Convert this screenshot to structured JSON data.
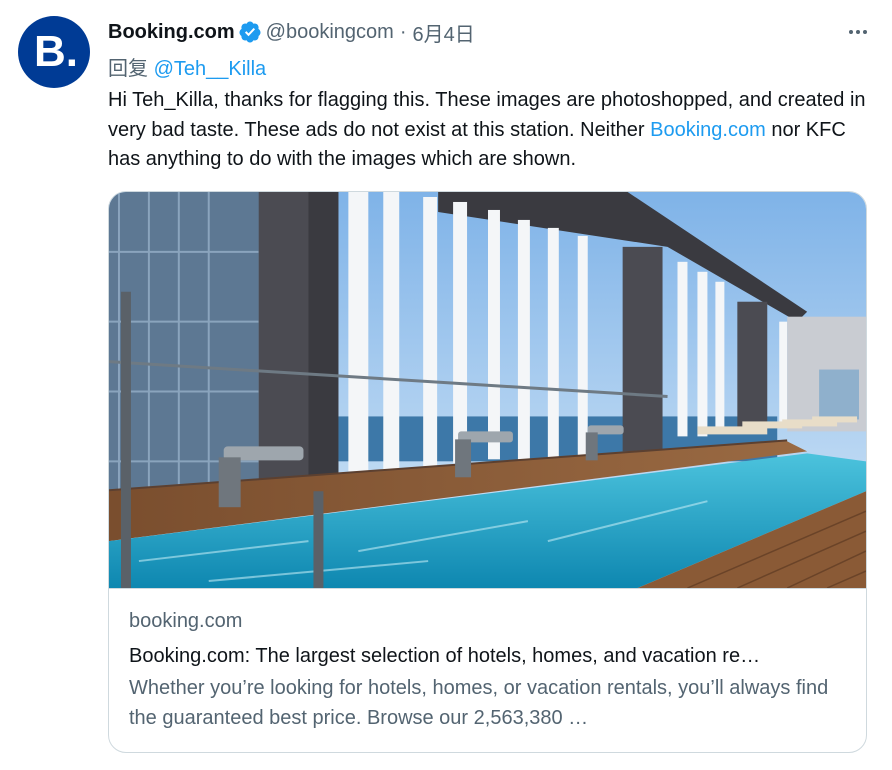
{
  "author": {
    "avatar_letter": "B.",
    "display_name": "Booking.com",
    "handle": "@bookingcom",
    "separator": "·",
    "date": "6月4日"
  },
  "reply": {
    "prefix": "回复",
    "mention": "@Teh__Killa"
  },
  "tweet": {
    "text_part1": "Hi Teh_Killa, thanks for flagging this. These images are photoshopped, and created in very bad taste. These ads do not exist at this station. Neither ",
    "link_text": "Booking.com",
    "text_part2": " nor KFC has anything to do with the images which are shown."
  },
  "card": {
    "domain": "booking.com",
    "title": "Booking.com: The largest selection of hotels, homes, and vacation re…",
    "description": "Whether you’re looking for hotels, homes, or vacation rentals, you’ll always find the guaranteed best price. Browse our 2,563,380 …"
  },
  "icons": {
    "verified": "verified-badge-icon",
    "more": "more-options-icon"
  },
  "colors": {
    "brand_blue": "#003b95",
    "link_blue": "#1d9bf0",
    "muted_text": "#536471",
    "pool_water": "#1fa3c4"
  }
}
